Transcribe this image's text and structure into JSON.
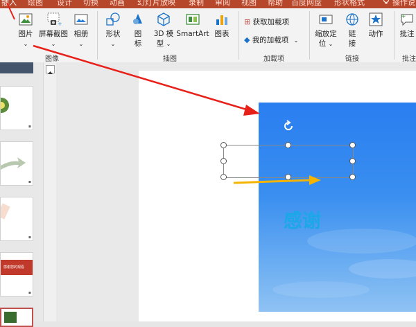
{
  "tabs": [
    {
      "label": "插入",
      "active": true
    },
    {
      "label": "绘图"
    },
    {
      "label": "设计"
    },
    {
      "label": "切换"
    },
    {
      "label": "动画"
    },
    {
      "label": "幻灯片放映"
    },
    {
      "label": "录制"
    },
    {
      "label": "审阅"
    },
    {
      "label": "视图"
    },
    {
      "label": "帮助"
    },
    {
      "label": "百度网盘"
    },
    {
      "label": "形状格式"
    },
    {
      "label": "操作说"
    }
  ],
  "ribbon": {
    "picture": "图片",
    "screenshot": "屏幕截图",
    "album": "相册",
    "group_images": "图像",
    "shapes": "形状",
    "icons_line1": "图",
    "icons_line2": "标",
    "model_line1": "3D 模",
    "model_line2": "型",
    "smartart": "SmartArt",
    "chart": "图表",
    "group_illustrations": "插图",
    "get_addins": "获取加载项",
    "my_addins": "我的加载项",
    "group_addins": "加载项",
    "zoom_line1": "缩放定",
    "zoom_line2": "位",
    "link_line1": "链",
    "link_line2": "接",
    "action": "动作",
    "group_links": "链接",
    "comment": "批注",
    "group_comments": "批注"
  },
  "thumbs": {
    "slide4_banner": "感谢您的观看"
  },
  "slide": {
    "textbox_text": "感谢"
  },
  "colors": {
    "accent": "#b7472a",
    "slide_text": "#1ba7e8",
    "annotation_red": "#e8201a",
    "annotation_orange": "#f5b400"
  }
}
